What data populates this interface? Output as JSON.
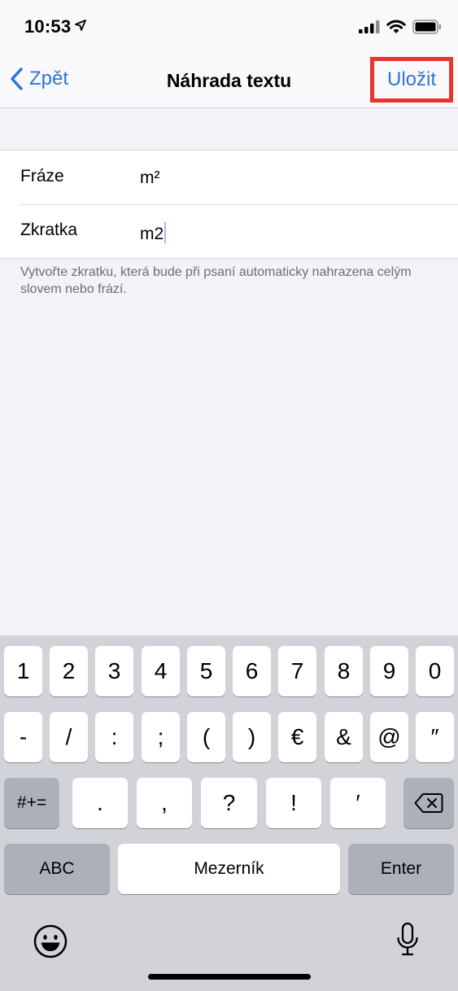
{
  "status_bar": {
    "time": "10:53",
    "icons": [
      "location-arrow-icon",
      "cellular-signal-icon",
      "wifi-icon",
      "battery-icon"
    ]
  },
  "nav": {
    "back_label": "Zpět",
    "title": "Náhrada textu",
    "save_label": "Uložit"
  },
  "form": {
    "rows": [
      {
        "label": "Fráze",
        "value": "m²"
      },
      {
        "label": "Zkratka",
        "value": "m2"
      }
    ],
    "footer": "Vytvořte zkratku, která bude při psaní automaticky nahrazena celým slovem nebo frází."
  },
  "keyboard": {
    "row1": [
      "1",
      "2",
      "3",
      "4",
      "5",
      "6",
      "7",
      "8",
      "9",
      "0"
    ],
    "row2": [
      "-",
      "/",
      ":",
      ";",
      "(",
      ")",
      "€",
      "&",
      "@",
      "″"
    ],
    "row3": {
      "switch": "#+=",
      "keys": [
        ".",
        ",",
        "?",
        "!",
        "′"
      ]
    },
    "row4": {
      "abc": "ABC",
      "space": "Mezerník",
      "enter": "Enter"
    }
  },
  "colors": {
    "accent": "#2f73d6",
    "highlight_border": "#e6372a",
    "keyboard_bg": "#d1d3d9",
    "background": "#f2f2f7"
  }
}
